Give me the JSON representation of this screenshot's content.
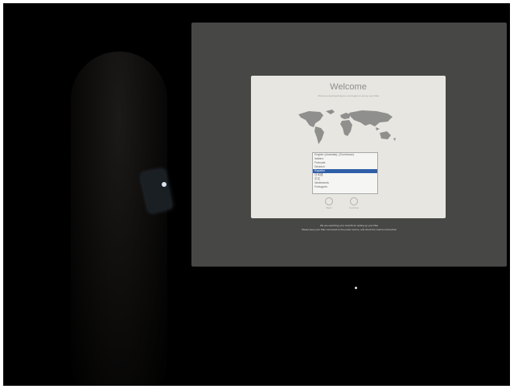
{
  "installer": {
    "title": "Welcome",
    "subtitle": "Choose a keyboard layout, and region to set up your Mac",
    "languages": [
      "English (Australia), (Dominican)",
      "Italiano",
      "Français",
      "Deutsch",
      "Español",
      "日本語",
      "中文",
      "Nederlands",
      "Português"
    ],
    "selected_index": 4,
    "back_label": "Back",
    "continue_label": "Continue",
    "footer_line1": "We are searching your macOS for setting up your Mac",
    "footer_line2": "Please keep your Mac connected to the power source, and check the internet connection"
  },
  "colors": {
    "screen_bg": "#474745",
    "dialog_bg": "#e7e6e1",
    "selection_blue": "#2f5fa8"
  }
}
